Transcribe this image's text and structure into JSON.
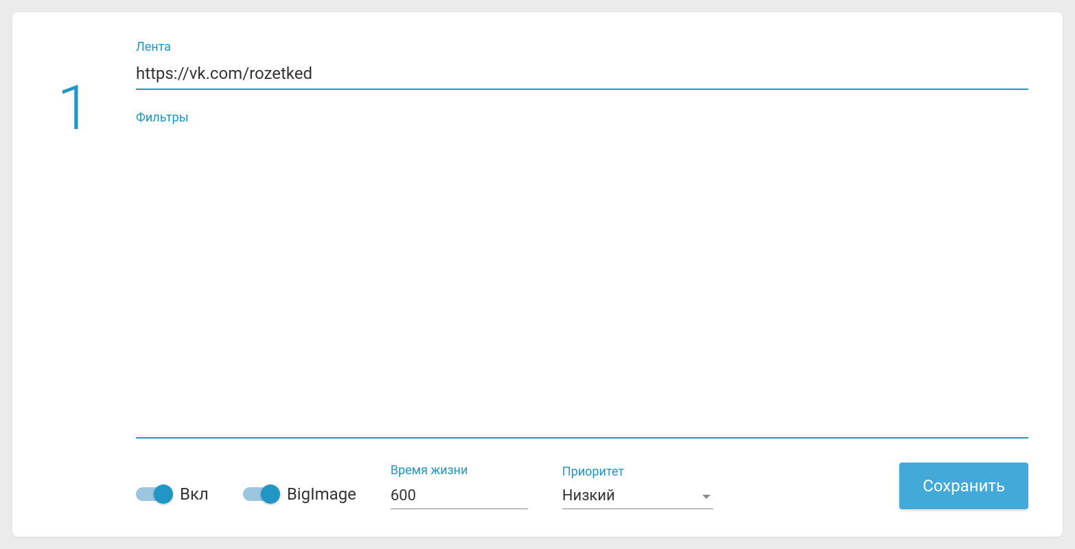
{
  "item": {
    "number": "1",
    "feed": {
      "label": "Лента",
      "value": "https://vk.com/rozetked"
    },
    "filters": {
      "label": "Фильтры"
    },
    "controls": {
      "enabled": {
        "label": "Вкл",
        "on": true
      },
      "bigimage": {
        "label": "BigImage",
        "on": true
      },
      "ttl": {
        "label": "Время жизни",
        "value": "600"
      },
      "priority": {
        "label": "Приоритет",
        "value": "Низкий"
      },
      "save_label": "Сохранить"
    }
  }
}
